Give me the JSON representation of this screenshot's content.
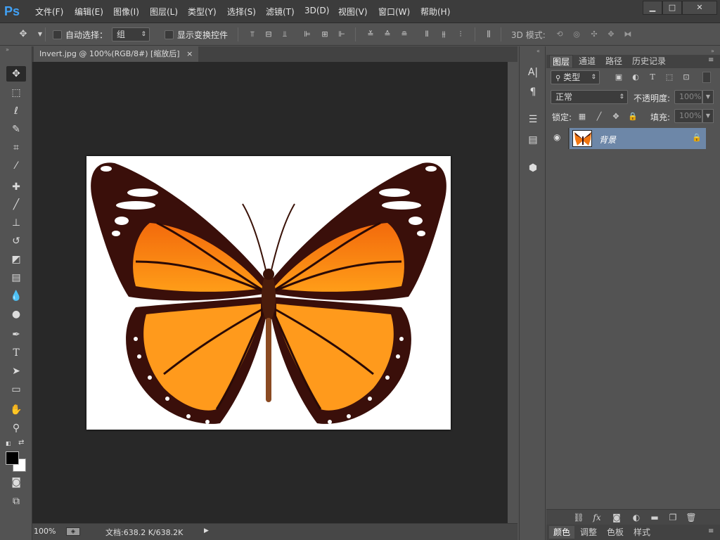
{
  "app": {
    "logo": "Ps"
  },
  "menu": [
    "文件(F)",
    "编辑(E)",
    "图像(I)",
    "图层(L)",
    "类型(Y)",
    "选择(S)",
    "滤镜(T)",
    "3D(D)",
    "视图(V)",
    "窗口(W)",
    "帮助(H)"
  ],
  "window_controls": {
    "minimize": "▁",
    "maximize": "□",
    "close": "✕"
  },
  "options": {
    "auto_select_label": "自动选择：",
    "auto_select_value": "组",
    "show_transform_label": "显示变换控件",
    "mode_3d_label": "3D 模式:"
  },
  "document": {
    "tab_title": "Invert.jpg @ 100%(RGB/8#) [缩放后]",
    "close_glyph": "×",
    "zoom": "100%",
    "doc_info": "文档:638.2 K/638.2K"
  },
  "layers_panel": {
    "tabs": [
      "图层",
      "通道",
      "路径",
      "历史记录"
    ],
    "kind_filter": "类型",
    "blend_mode": "正常",
    "opacity_label": "不透明度:",
    "opacity_value": "100%",
    "lock_label": "锁定:",
    "fill_label": "填充:",
    "fill_value": "100%",
    "layer_name": "背景"
  },
  "bottom_tabs": [
    "颜色",
    "调整",
    "色板",
    "样式"
  ],
  "colors": {
    "accent": "#6d87a8",
    "logo": "#41a1f5",
    "canvas_bg": "#282828"
  }
}
